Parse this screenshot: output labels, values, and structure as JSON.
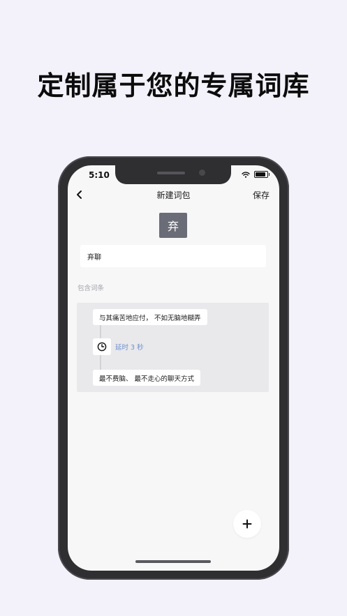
{
  "headline": "定制属于您的专属词库",
  "status_bar": {
    "time": "5:10",
    "icons": [
      "wifi-icon",
      "battery-icon"
    ]
  },
  "navbar": {
    "back_icon": "chevron-left-icon",
    "title": "新建词包",
    "save_label": "保存"
  },
  "pack": {
    "avatar_char": "弃",
    "name_value": "弃聊"
  },
  "entries": {
    "section_label": "包含词条",
    "items": [
      {
        "type": "text",
        "text": "与其痛苦地应付， 不如无脑地糊弄"
      },
      {
        "type": "delay",
        "icon": "clock-icon",
        "text": "延时 3 秒"
      },
      {
        "type": "text",
        "text": "最不费脑、 最不走心的聊天方式"
      }
    ]
  },
  "fab": {
    "icon": "plus-icon"
  },
  "colors": {
    "background": "#f3f2fb",
    "phone_frame": "#2f2f32",
    "screen": "#f7f7f8",
    "avatar": "#6a6c77",
    "delay_text": "#6f8fcf",
    "panel": "#e9e9eb"
  }
}
